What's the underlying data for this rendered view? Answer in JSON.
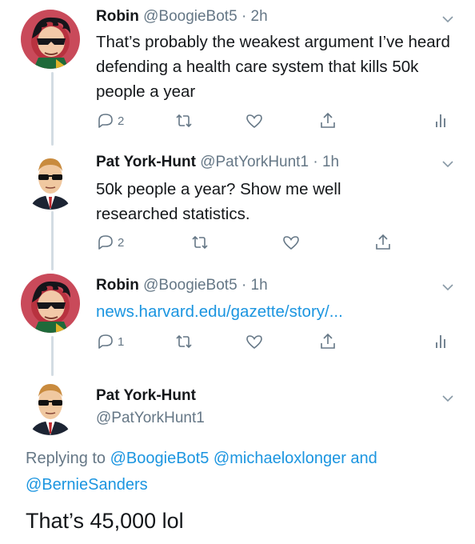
{
  "tweets": [
    {
      "name": "Robin",
      "handle": "@BoogieBot5",
      "sep": "·",
      "time": "2h",
      "text": "That’s probably the weakest argument I’ve heard defending a health care system that kills 50k people a year",
      "reply_count": "2"
    },
    {
      "name": "Pat York-Hunt",
      "handle": "@PatYorkHunt1",
      "sep": "·",
      "time": "1h",
      "text": "50k people a year? Show me well researched statistics.",
      "reply_count": "2"
    },
    {
      "name": "Robin",
      "handle": "@BoogieBot5",
      "sep": "·",
      "time": "1h",
      "link": "news.harvard.edu/gazette/story/...",
      "reply_count": "1"
    }
  ],
  "final_tweet": {
    "name": "Pat York-Hunt",
    "handle": "@PatYorkHunt1",
    "replying_prefix": "Replying to",
    "mention1": "@BoogieBot5",
    "mention2": "@michaeloxlonger",
    "and": "and",
    "mention3": "@BernieSanders",
    "text": "That’s 45,000 lol"
  },
  "icons": {
    "reply": "reply-icon",
    "retweet": "retweet-icon",
    "like": "heart-icon",
    "share": "share-icon",
    "analytics": "analytics-icon",
    "menu": "chevron-down-icon"
  },
  "colors": {
    "link": "#1b95e0",
    "muted": "#657786",
    "text": "#14171a",
    "thread_line": "#d3dce3"
  }
}
